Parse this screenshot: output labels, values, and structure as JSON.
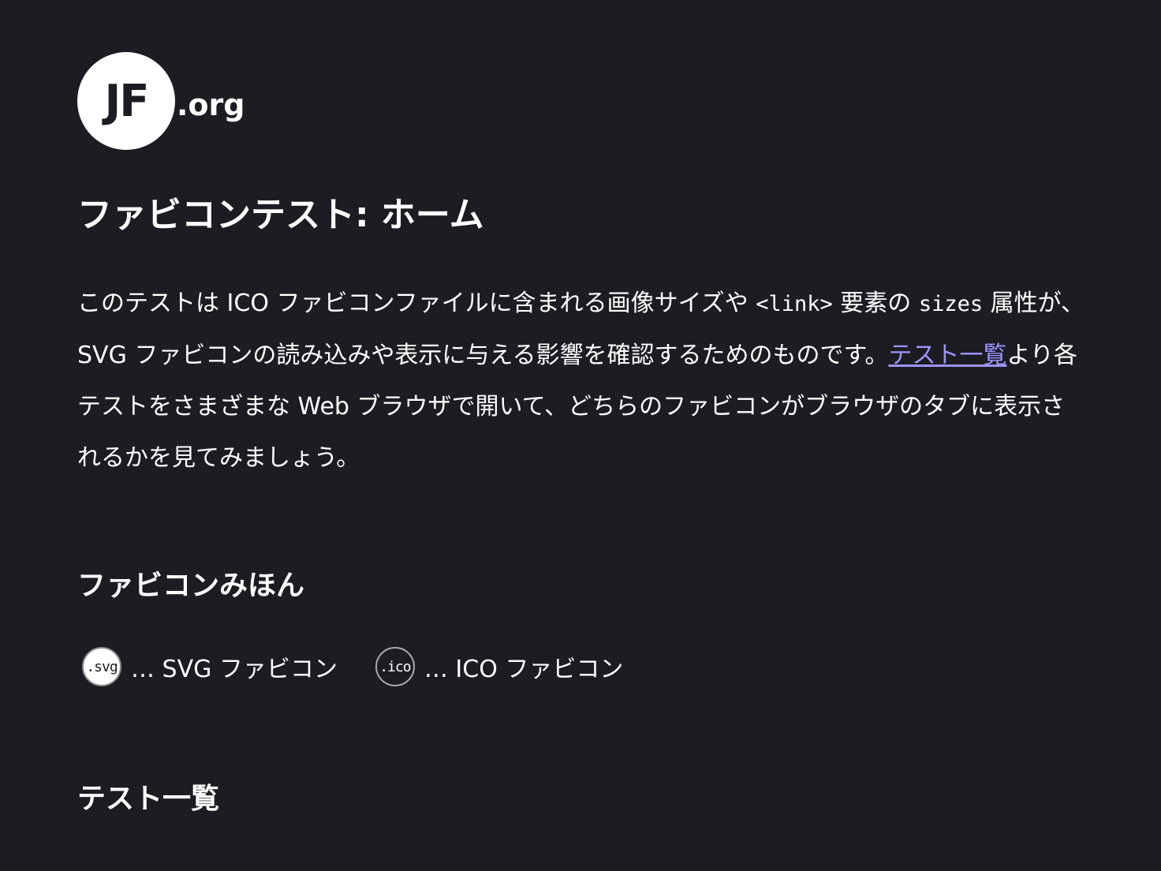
{
  "logo": {
    "mark": "JF",
    "suffix": ".org"
  },
  "page_title": "ファビコンテスト: ホーム",
  "intro": {
    "part1": "このテストは ICO ファビコンファイルに含まれる画像サイズや ",
    "code1": "<link>",
    "part2": " 要素の ",
    "code2": "sizes",
    "part3": " 属性が、SVG ファビコンの読み込みや表示に与える影響を確認するためのものです。",
    "link_text": "テスト一覧",
    "part4": "より各テストをさまざまな Web ブラウザで開いて、どちらのファビコンがブラウザのタブに表示されるかを見てみましょう。"
  },
  "sample_section": {
    "heading": "ファビコンみほん",
    "items": [
      {
        "badge": ".svg",
        "label": "… SVG ファビコン"
      },
      {
        "badge": ".ico",
        "label": "… ICO ファビコン"
      }
    ]
  },
  "test_list": {
    "heading": "テスト一覧"
  },
  "colors": {
    "background": "#1d1c22",
    "text": "#ffffff",
    "link": "#9c94ff"
  }
}
